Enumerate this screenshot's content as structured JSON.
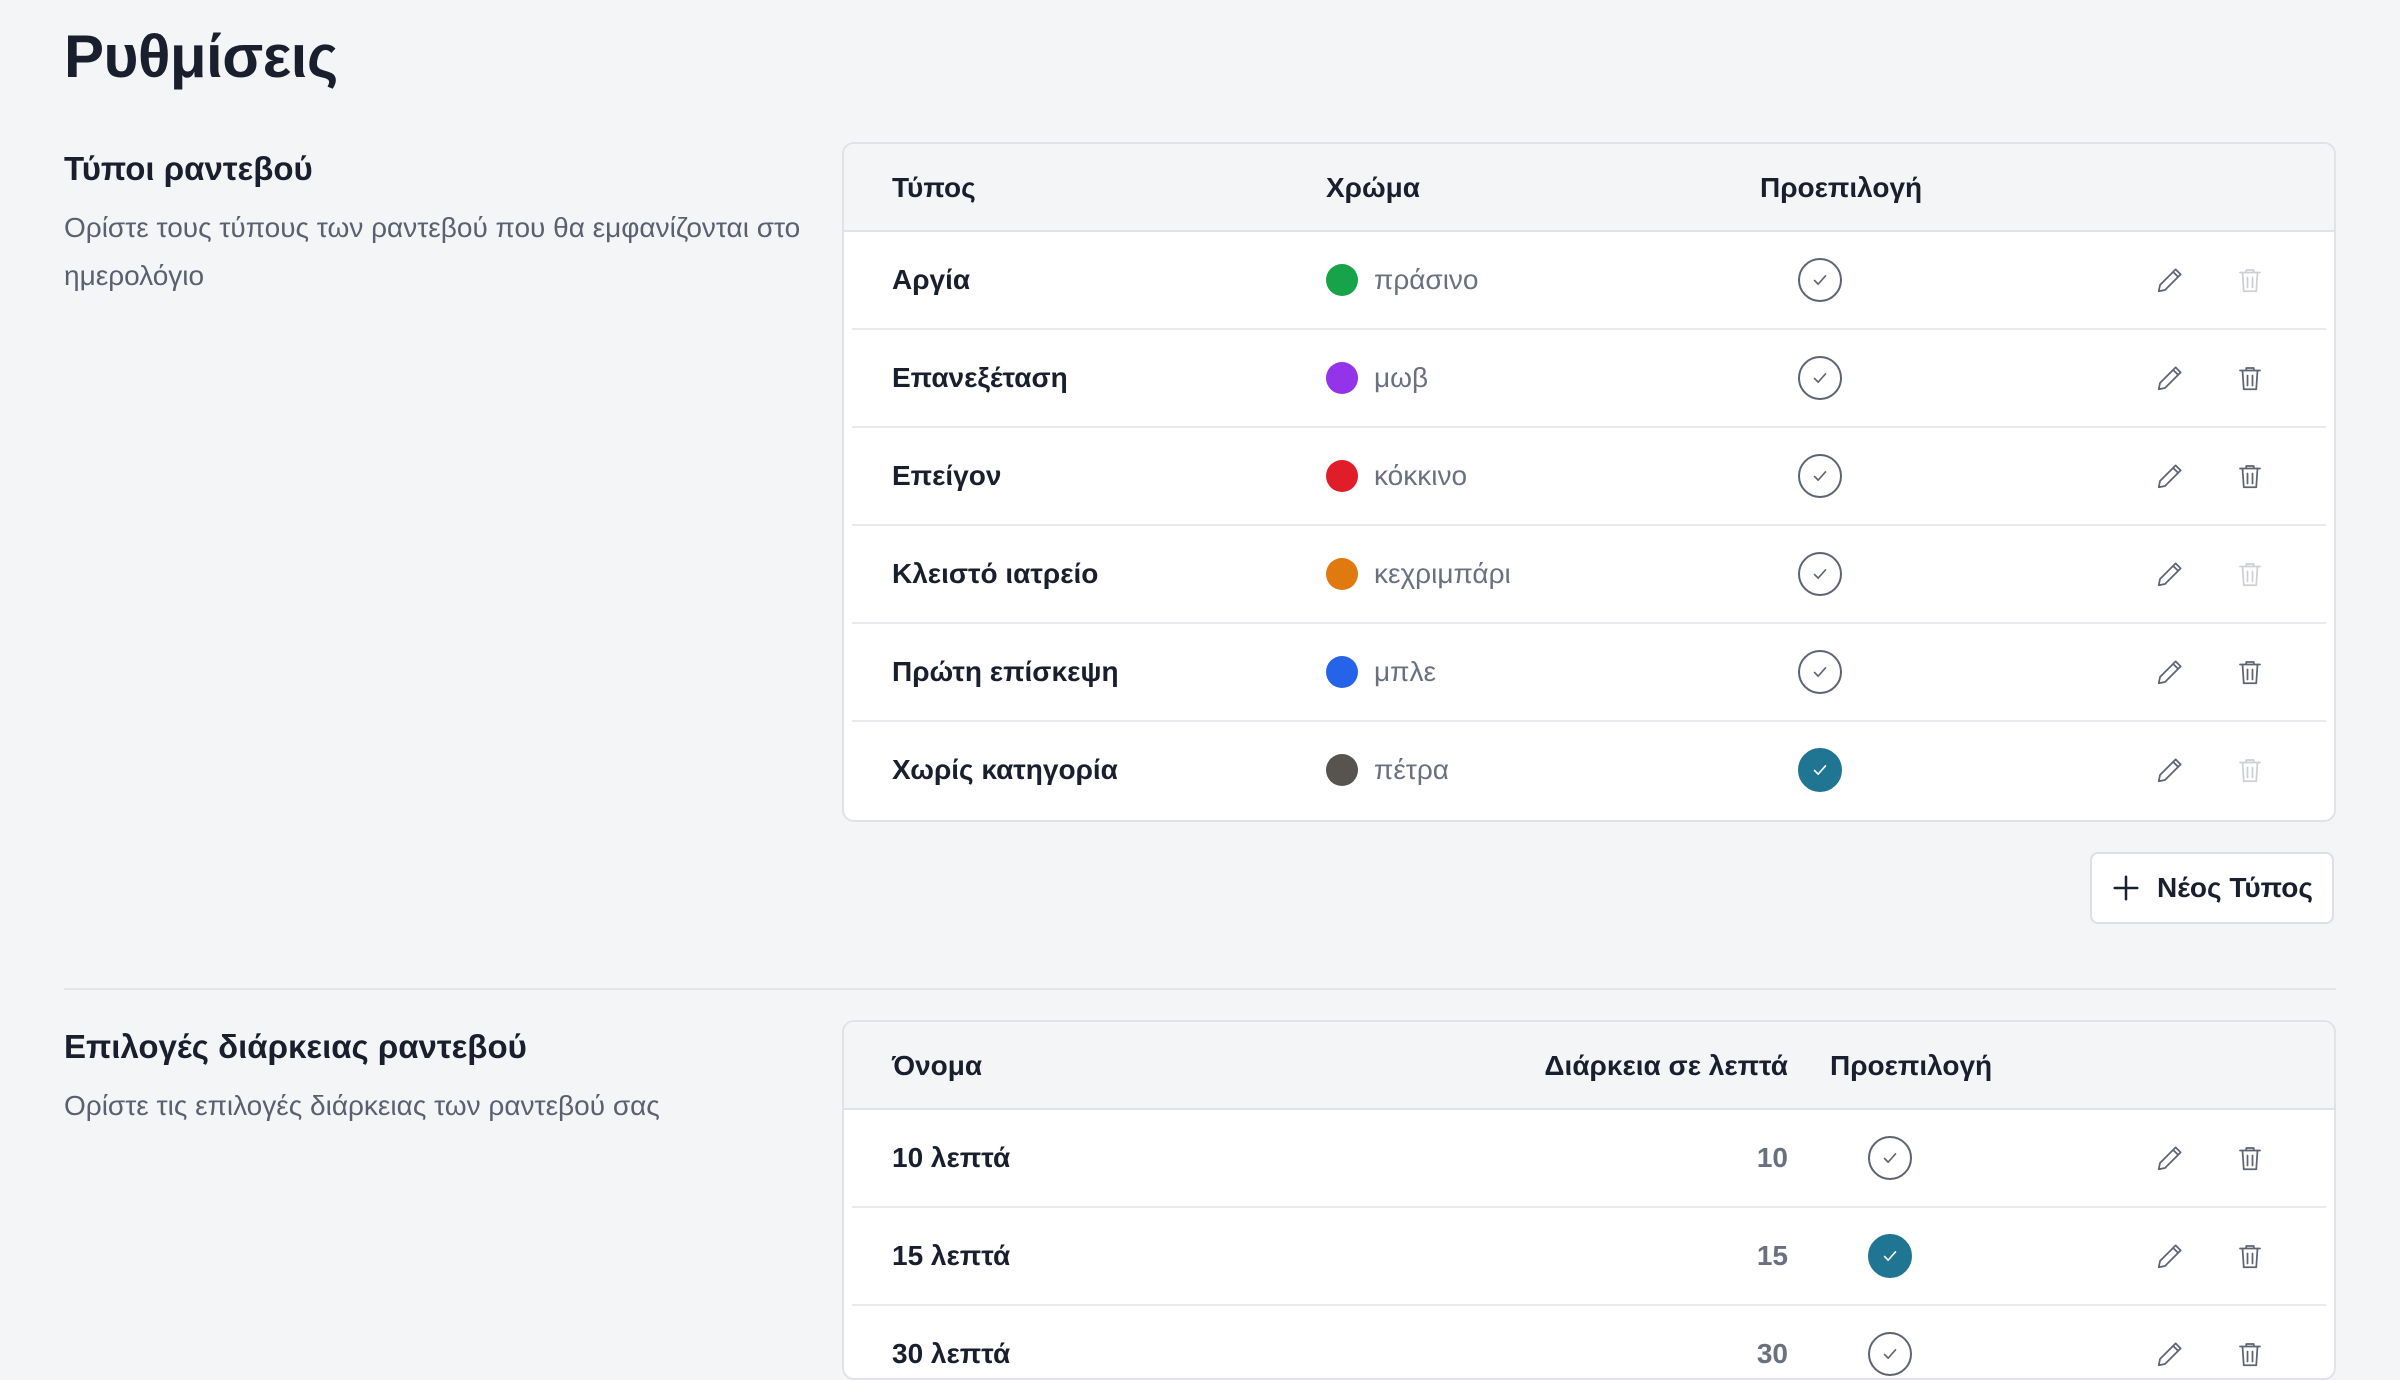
{
  "page": {
    "title": "Ρυθμίσεις"
  },
  "appointment_types": {
    "title": "Τύποι ραντεβού",
    "description": "Ορίστε τους τύπους των ραντεβού που θα εμφανίζονται στο ημερολόγιο",
    "headers": {
      "type": "Τύπος",
      "color": "Χρώμα",
      "default": "Προεπιλογή"
    },
    "rows": [
      {
        "name": "Αργία",
        "color_name": "πράσινο",
        "color_hex": "#16a34a",
        "default": false,
        "delete_enabled": false
      },
      {
        "name": "Επανεξέταση",
        "color_name": "μωβ",
        "color_hex": "#9333ea",
        "default": false,
        "delete_enabled": true
      },
      {
        "name": "Επείγον",
        "color_name": "κόκκινο",
        "color_hex": "#e11d2a",
        "default": false,
        "delete_enabled": true
      },
      {
        "name": "Κλειστό ιατρείο",
        "color_name": "κεχριμπάρι",
        "color_hex": "#e07a10",
        "default": false,
        "delete_enabled": false
      },
      {
        "name": "Πρώτη επίσκεψη",
        "color_name": "μπλε",
        "color_hex": "#2563eb",
        "default": false,
        "delete_enabled": true
      },
      {
        "name": "Χωρίς κατηγορία",
        "color_name": "πέτρα",
        "color_hex": "#57534e",
        "default": true,
        "delete_enabled": false
      }
    ],
    "add_button_label": "Νέος Τύπος"
  },
  "durations": {
    "title": "Επιλογές διάρκειας ραντεβού",
    "description": "Ορίστε τις επιλογές διάρκειας των ραντεβού σας",
    "headers": {
      "name": "Όνομα",
      "minutes": "Διάρκεια σε λεπτά",
      "default": "Προεπιλογή"
    },
    "rows": [
      {
        "name": "10 λεπτά",
        "minutes": "10",
        "default": false,
        "delete_enabled": true
      },
      {
        "name": "15 λεπτά",
        "minutes": "15",
        "default": true,
        "delete_enabled": true
      },
      {
        "name": "30 λεπτά",
        "minutes": "30",
        "default": false,
        "delete_enabled": true
      }
    ]
  },
  "colors": {
    "accent": "#1f7592",
    "background": "#f4f5f7"
  },
  "icons": {
    "edit": "pencil-icon",
    "delete": "trash-icon",
    "default": "check-circle-icon",
    "add": "plus-icon"
  }
}
